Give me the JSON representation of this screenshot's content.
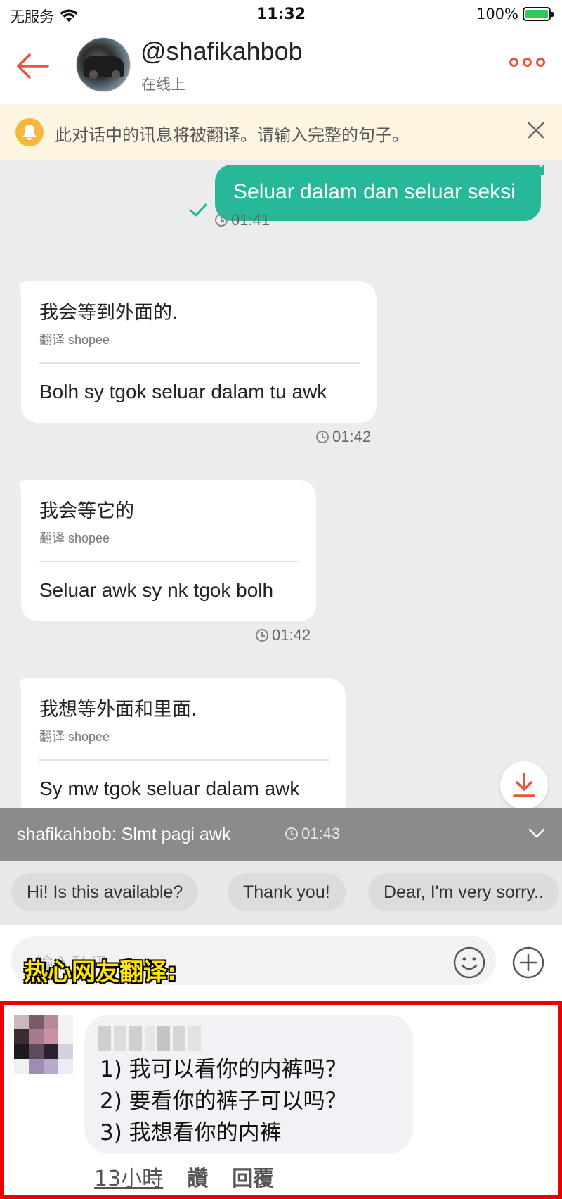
{
  "status_bar": {
    "carrier": "无服务",
    "time": "11:32",
    "battery": "100%"
  },
  "header": {
    "username": "@shafikahbob",
    "status": "在线上"
  },
  "notice": {
    "text": "此对话中的讯息将被翻译。请输入完整的句子。"
  },
  "messages": {
    "out1": {
      "text": "Seluar dalam dan seluar seksi",
      "time": "01:41"
    },
    "in1": {
      "translated": "我会等到外面的.",
      "label": "翻译 shopee",
      "original": "Bolh sy tgok seluar dalam tu awk",
      "time": "01:42"
    },
    "in2": {
      "translated": "我会等它的",
      "label": "翻译 shopee",
      "original": "Seluar awk sy nk tgok bolh",
      "time": "01:42"
    },
    "in3": {
      "translated": "我想等外面和里面.",
      "label": "翻译 shopee",
      "original": "Sy mw tgok seluar dalam awk"
    }
  },
  "preview": {
    "text": "shafikahbob: Slmt pagi awk",
    "time": "01:43"
  },
  "quick_replies": [
    "Hi! Is this available?",
    "Thank you!",
    "Dear, I'm very sorry.."
  ],
  "input": {
    "placeholder": "输入私讯"
  },
  "overlay": {
    "title": "热心网友翻译:"
  },
  "comment": {
    "lines": [
      "1) 我可以看你的内裤吗？",
      "2) 要看你的裤子可以吗？",
      "3) 我想看你的内裤"
    ],
    "time": "13小時",
    "like": "讚",
    "reply": "回覆"
  },
  "colors": {
    "accent": "#e8553a",
    "sent_bubble": "#27b89a",
    "notice_bg": "#fdf5e2",
    "highlight_border": "#ea0000"
  }
}
